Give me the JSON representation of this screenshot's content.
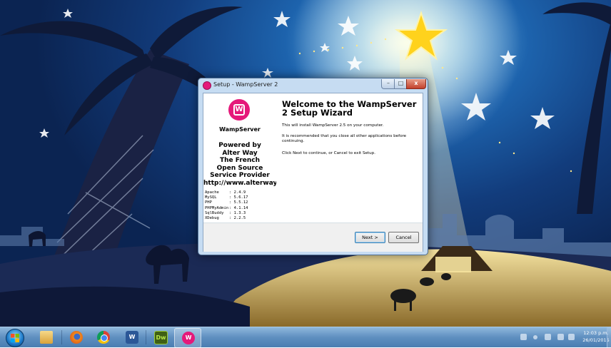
{
  "window": {
    "title": "Setup - WampServer 2",
    "controls": {
      "minimize": "–",
      "maximize": "□",
      "close": "x"
    }
  },
  "left_pane": {
    "logo_letter": "W",
    "brand": "WampServer",
    "powered_lines": [
      "Powered by",
      "Alter Way",
      "The French",
      "Open Source",
      "Service Provider",
      "http://www.alterway.fr"
    ],
    "versions": [
      {
        "name": "Apache",
        "value": ": 2.4.9"
      },
      {
        "name": "MySQL",
        "value": ": 5.6.17"
      },
      {
        "name": "PHP",
        "value": ": 5.5.12"
      },
      {
        "name": "PHPMyAdmin",
        "value": ": 4.1.14"
      },
      {
        "name": "SqlBuddy",
        "value": ": 1.3.3"
      },
      {
        "name": "XDebug",
        "value": ": 2.2.5"
      }
    ]
  },
  "right_pane": {
    "heading": "Welcome to the WampServer 2 Setup Wizard",
    "para1": "This will install WampServer 2.5 on your computer.",
    "para2": "It is recommended that you close all other applications before continuing.",
    "para3": "Click Next to continue, or Cancel to exit Setup."
  },
  "buttons": {
    "next": "Next >",
    "cancel": "Cancel"
  },
  "taskbar": {
    "apps": [
      {
        "name": "explorer",
        "glyph": ""
      },
      {
        "name": "firefox",
        "glyph": ""
      },
      {
        "name": "chrome",
        "glyph": ""
      },
      {
        "name": "word",
        "glyph": "W"
      },
      {
        "name": "dreamweaver",
        "glyph": "Dw"
      },
      {
        "name": "wampserver",
        "glyph": "W"
      }
    ],
    "clock_time": "12:03 p.m.",
    "clock_date": "26/01/2015"
  }
}
